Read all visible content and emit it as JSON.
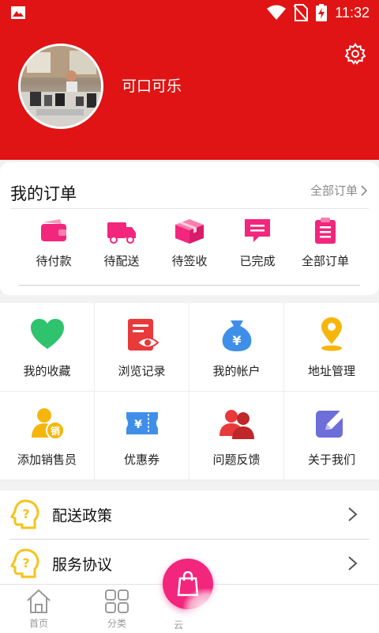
{
  "status_bar": {
    "time": "11:32",
    "icons": [
      "image-icon",
      "wifi-icon",
      "no-sim-icon",
      "battery-charging-icon"
    ]
  },
  "profile": {
    "username": "可口可乐",
    "avatar_icon": "avatar-photo",
    "settings_icon": "gear-icon"
  },
  "orders": {
    "title": "我的订单",
    "all_link": "全部订单",
    "items": [
      {
        "label": "待付款",
        "icon": "wallet-icon"
      },
      {
        "label": "待配送",
        "icon": "truck-icon"
      },
      {
        "label": "待签收",
        "icon": "box-icon"
      },
      {
        "label": "已完成",
        "icon": "message-icon"
      },
      {
        "label": "全部订单",
        "icon": "clipboard-icon"
      }
    ]
  },
  "services": [
    {
      "label": "我的收藏",
      "icon": "heart-icon"
    },
    {
      "label": "浏览记录",
      "icon": "eye-doc-icon"
    },
    {
      "label": "我的帐户",
      "icon": "money-bag-icon"
    },
    {
      "label": "地址管理",
      "icon": "location-pin-icon"
    },
    {
      "label": "添加销售员",
      "icon": "salesperson-icon"
    },
    {
      "label": "优惠券",
      "icon": "coupon-icon"
    },
    {
      "label": "问题反馈",
      "icon": "people-icon"
    },
    {
      "label": "关于我们",
      "icon": "edit-icon"
    }
  ],
  "menu": [
    {
      "label": "配送政策",
      "icon": "question-head-icon"
    },
    {
      "label": "服务协议",
      "icon": "question-head-icon"
    }
  ],
  "tabs": [
    {
      "label": "首页",
      "icon": "home-icon"
    },
    {
      "label": "分类",
      "icon": "grid-icon"
    },
    {
      "label": "云",
      "icon": "cloud-icon"
    }
  ],
  "colors": {
    "brand_red": "#e01414",
    "pink": "#f2267d",
    "green": "#2ec36c",
    "blue": "#3f8fe8",
    "yellow": "#f5b60c",
    "purple": "#6d6ed8"
  }
}
